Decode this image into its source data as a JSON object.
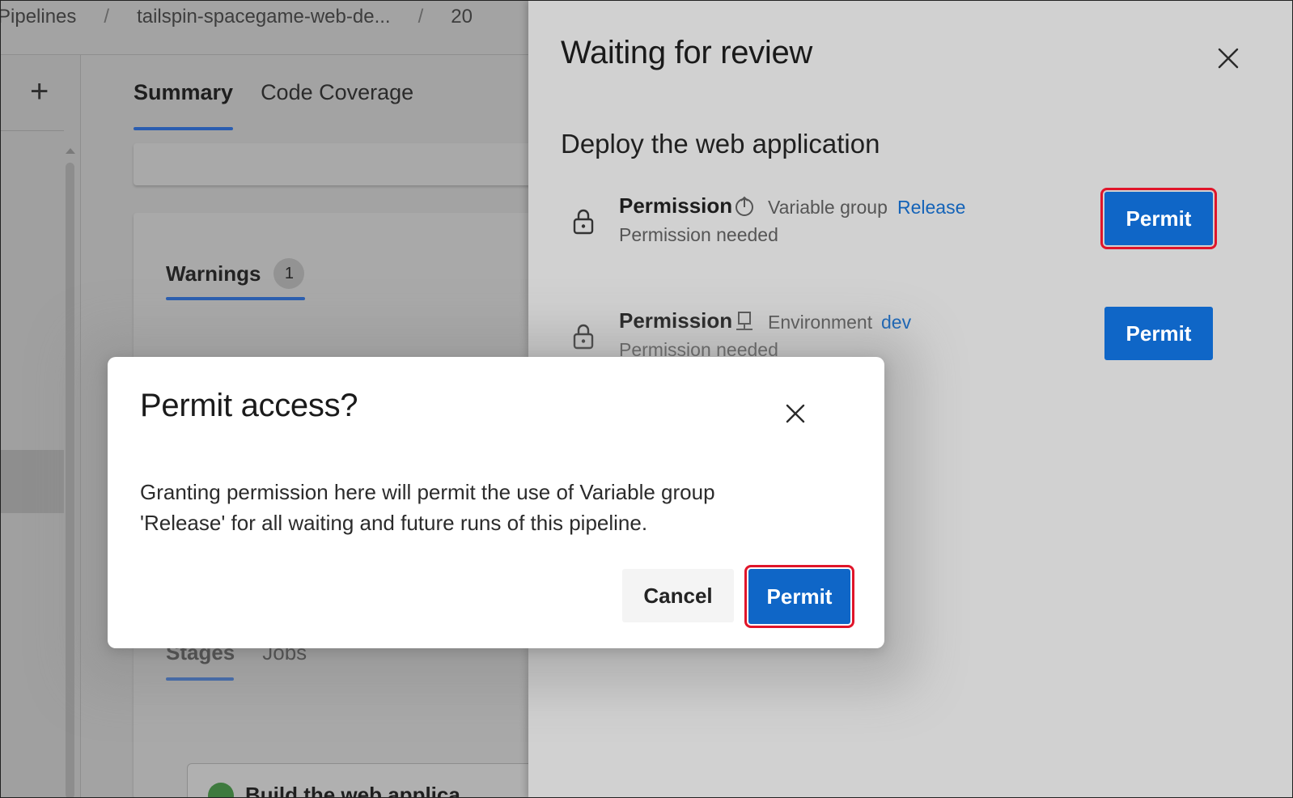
{
  "breadcrumb": {
    "items": [
      "Pipelines",
      "tailspin-spacegame-web-de...",
      "20"
    ],
    "separator": "/"
  },
  "background": {
    "add_label": "+",
    "tabs": [
      {
        "label": "Summary",
        "active": true
      },
      {
        "label": "Code Coverage",
        "active": false
      }
    ],
    "warnings": {
      "label": "Warnings",
      "count": "1"
    },
    "stage_tabs": [
      "Stages",
      "Jobs"
    ],
    "job_title": "Build the web applica"
  },
  "panel": {
    "title": "Waiting for review",
    "subtitle": "Deploy the web application",
    "permissions": [
      {
        "title": "Permission",
        "icon": "variable-group-icon",
        "kind": "Variable group",
        "resource": "Release",
        "status": "Permission needed",
        "button_label": "Permit",
        "highlighted": true
      },
      {
        "title": "Permission",
        "icon": "environment-icon",
        "kind": "Environment",
        "resource": "dev",
        "status": "Permission needed",
        "button_label": "Permit",
        "highlighted": false
      }
    ]
  },
  "dialog": {
    "title": "Permit access?",
    "message_line1": "Granting permission here will permit the use of Variable group",
    "message_line2": "'Release' for all waiting and future runs of this pipeline.",
    "cancel_label": "Cancel",
    "permit_label": "Permit"
  },
  "colors": {
    "primary": "#0f66c7",
    "link": "#1463b8",
    "highlight": "#e0152a",
    "tab_underline": "#2a5db0"
  }
}
